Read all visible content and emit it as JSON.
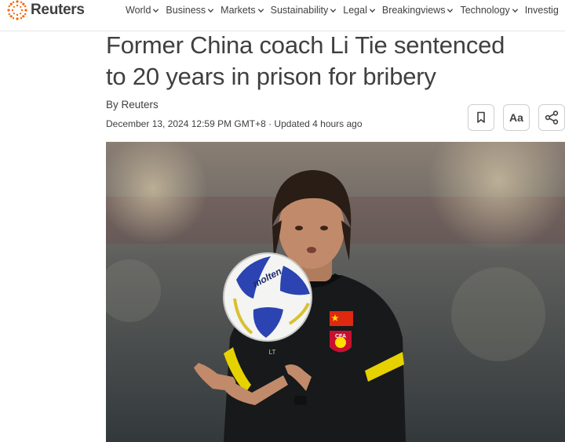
{
  "brand": {
    "name": "Reuters"
  },
  "nav": {
    "items": [
      {
        "label": "World"
      },
      {
        "label": "Business"
      },
      {
        "label": "Markets"
      },
      {
        "label": "Sustainability"
      },
      {
        "label": "Legal"
      },
      {
        "label": "Breakingviews"
      },
      {
        "label": "Technology"
      },
      {
        "label": "Investig"
      }
    ]
  },
  "article": {
    "headline_line1": "Former China coach Li Tie sentenced",
    "headline_line2": "to 20 years in prison for bribery",
    "byline": "By Reuters",
    "dateline": "December 13, 2024 12:59 PM GMT+8 · Updated 4 hours ago",
    "text_size_label": "Aa"
  },
  "photo": {
    "ball_text": "molten",
    "crest_text": "CFA",
    "initials": "LT"
  },
  "colors": {
    "brand_orange": "#fa6400",
    "text": "#404040",
    "jersey_accent": "#e6d200"
  }
}
